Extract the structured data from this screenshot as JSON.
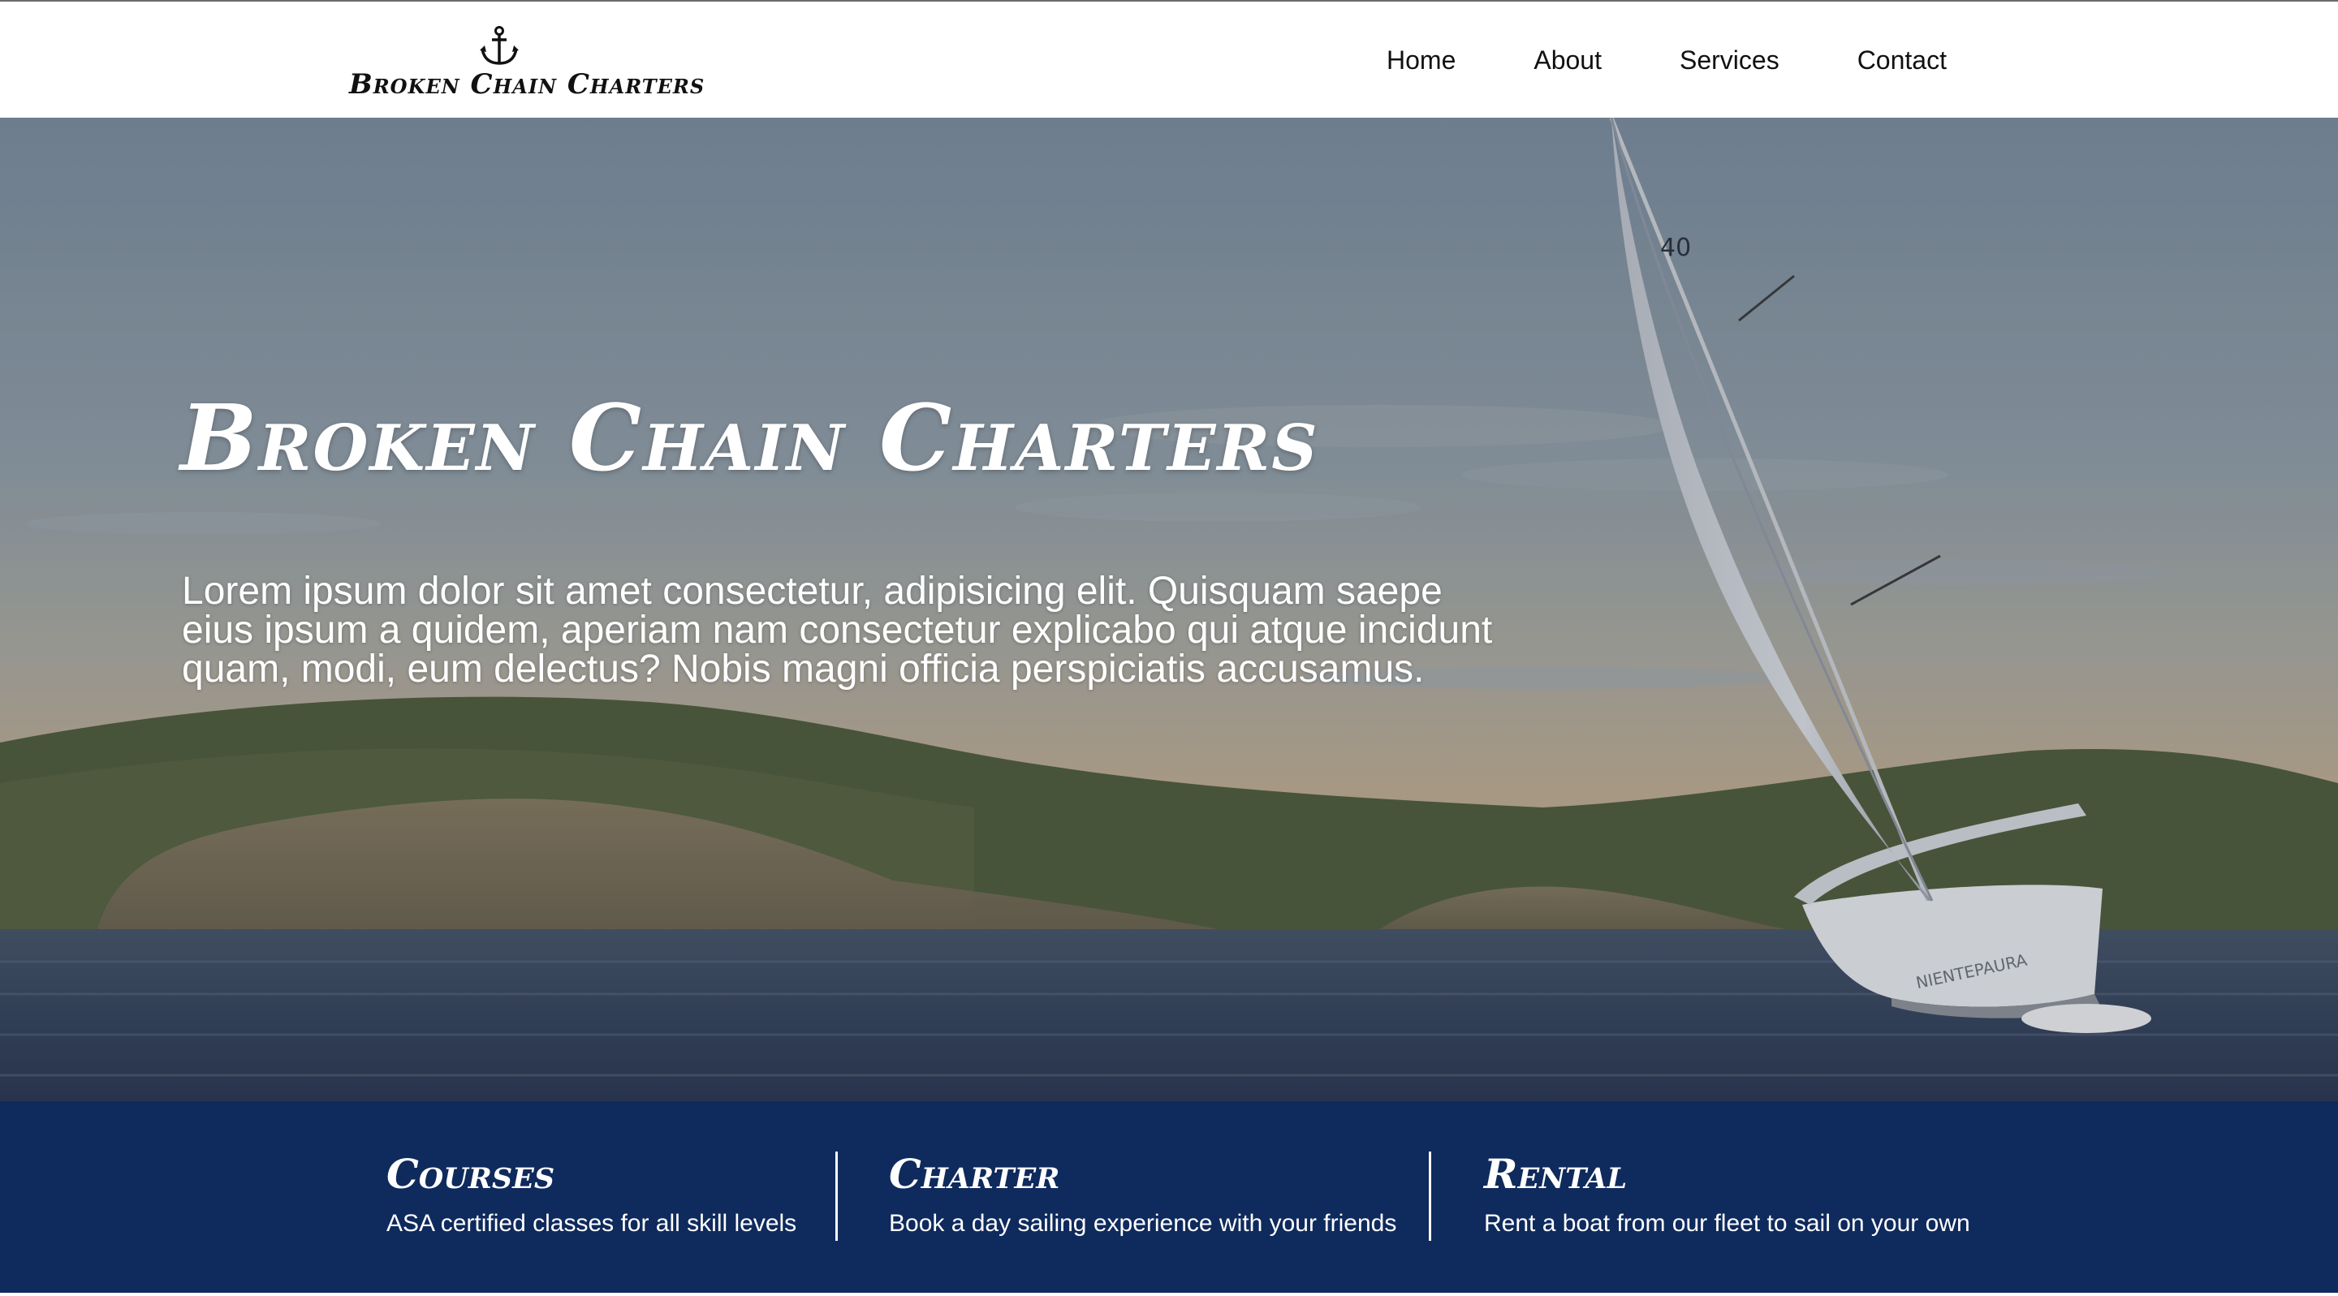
{
  "header": {
    "logo_text": "Broken Chain Charters",
    "logo_icon": "anchor-icon",
    "nav": [
      {
        "label": "Home"
      },
      {
        "label": "About"
      },
      {
        "label": "Services"
      },
      {
        "label": "Contact"
      }
    ]
  },
  "hero": {
    "title": "Broken Chain Charters",
    "text": "Lorem ipsum dolor sit amet consectetur, adipisicing elit. Quisquam saepe eius ipsum a quidem, aperiam nam consectetur explicabo qui atque incidunt quam, modi, eum delectus? Nobis magni officia perspiciatis accusamus.",
    "sail_number": "40",
    "boat_name": "NIENTEPAURA"
  },
  "features": [
    {
      "title": "Courses",
      "description": "ASA certified classes for all skill levels"
    },
    {
      "title": "Charter",
      "description": "Book a day sailing experience with your friends"
    },
    {
      "title": "Rental",
      "description": "Rent a boat from our fleet to sail on your own"
    }
  ],
  "colors": {
    "header_bg": "#ffffff",
    "band_bg": "#0f2a5c",
    "text_dark": "#111111",
    "text_light": "#ffffff"
  }
}
